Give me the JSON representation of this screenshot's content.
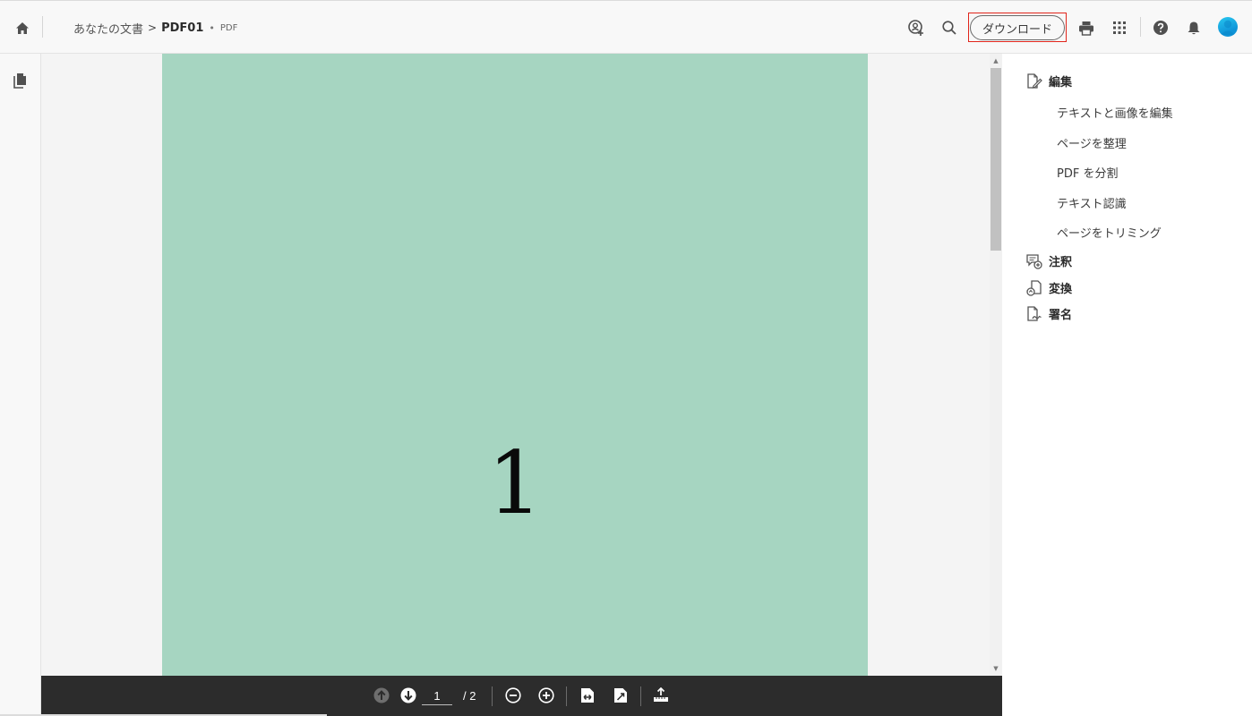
{
  "topbar": {
    "breadcrumb_root": "あなたの文書",
    "breadcrumb_arrow": ">",
    "document_name": "PDF01",
    "separator_dot": "•",
    "document_type": "PDF",
    "download_label": "ダウンロード"
  },
  "document": {
    "page_content": "1"
  },
  "pagination": {
    "current_page": "1",
    "total_label": "/ 2"
  },
  "tools": {
    "edit": {
      "label": "編集",
      "items": [
        "テキストと画像を編集",
        "ページを整理",
        "PDF を分割",
        "テキスト認識",
        "ページをトリミング"
      ]
    },
    "comment": {
      "label": "注釈"
    },
    "convert": {
      "label": "変換"
    },
    "sign": {
      "label": "署名"
    }
  },
  "colors": {
    "page_background": "#a6d5c1",
    "toolbar_dark": "#2c2c2c",
    "highlight": "#e1251b",
    "avatar": "#1ea7e8"
  },
  "icons": {
    "home": "home-icon",
    "share": "share-user-icon",
    "search": "search-icon",
    "print": "printer-icon",
    "apps": "apps-grid-icon",
    "help": "help-icon",
    "notifications": "bell-icon",
    "pages": "pages-icon"
  }
}
